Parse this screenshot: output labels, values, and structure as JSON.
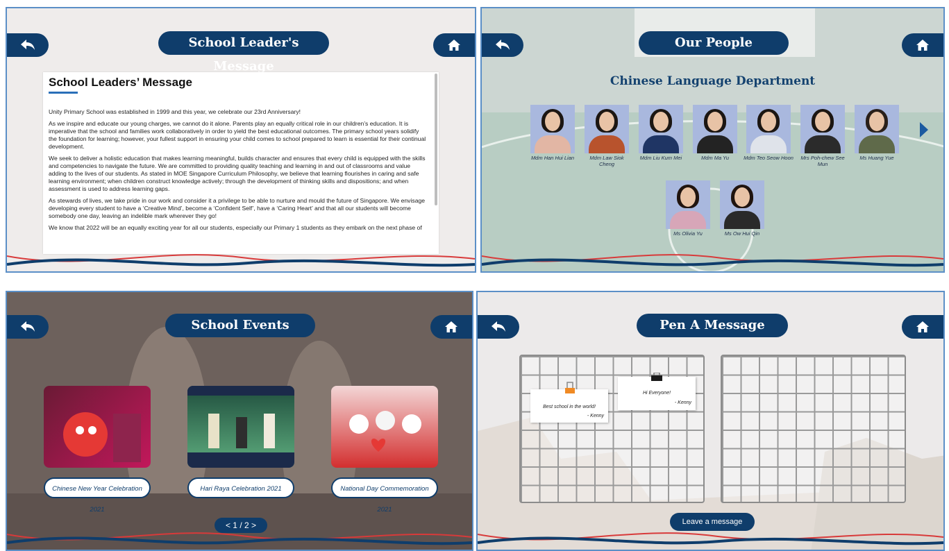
{
  "panels": {
    "leaders": {
      "title": "School Leader's Message",
      "doc_heading": "School Leaders’ Message",
      "paragraphs": [
        "Unity Primary School was established in 1999 and this year, we celebrate our 23rd Anniversary!",
        "As we inspire and educate our young charges, we cannot do it alone. Parents play an equally critical role in our children’s education. It is imperative that the school and families work collaboratively in order to yield the best educational outcomes. The primary school years solidify the foundation for learning; however, your fullest support in ensuring your child comes to school prepared to learn is essential for their continual development.",
        "We seek to deliver a holistic education that makes learning meaningful, builds character and ensures that every child is equipped with the skills and competencies to navigate the future. We are committed to providing quality teaching and learning in and out of classrooms and value adding to the lives of our students. As stated in MOE Singapore Curriculum Philosophy, we believe that learning flourishes in caring and safe learning environment; when children construct knowledge actively; through the development of thinking skills and dispositions; and when assessment is used to address learning gaps.",
        "As stewards of lives, we take pride in our work and consider it a privilege to be able to nurture and mould the future of Singapore. We envisage developing every student to have a ‘Creative Mind’, become a ‘Confident Self’, have a ‘Caring Heart’ and that all our students will become somebody one day, leaving an indelible mark wherever they go!",
        "We know that 2022 will be an equally exciting year for all our students, especially our Primary 1 students as they embark on the next phase of"
      ]
    },
    "people": {
      "title": "Our People",
      "department": "Chinese Language Department",
      "staff": [
        {
          "name": "Mdm Han Hui Lian",
          "top": "#e2b6a4",
          "hair": "#1c1612"
        },
        {
          "name": "Mdm Law Siok Cheng",
          "top": "#b8532d",
          "hair": "#1c1612"
        },
        {
          "name": "Mdm Liu Kum Mei",
          "top": "#1f3564",
          "hair": "#1c1612"
        },
        {
          "name": "Mdm Ma Yu",
          "top": "#232323",
          "hair": "#1c1612"
        },
        {
          "name": "Mdm Teo Seow Hoon",
          "top": "#dfe3ea",
          "hair": "#1c1612"
        },
        {
          "name": "Mrs Poh-chew See Mun",
          "top": "#2b2b2b",
          "hair": "#1c1612"
        },
        {
          "name": "Ms Huang Yue",
          "top": "#5f6a4a",
          "hair": "#2a201a"
        },
        {
          "name": "Ms Olivia Yu",
          "top": "#d7a6b8",
          "hair": "#20140f"
        },
        {
          "name": "Ms Ow Hui Qin",
          "top": "#2a2a2a",
          "hair": "#20140f"
        }
      ]
    },
    "events": {
      "title": "School Events",
      "items": [
        {
          "label": "Chinese New Year Celebration 2021",
          "bg1": "#6a1a35",
          "bg2": "#c2185b",
          "accent": "#e53935"
        },
        {
          "label": "Hari Raya Celebration 2021",
          "bg1": "#1f4e3d",
          "bg2": "#5fae7f",
          "accent": "#1b2a4a"
        },
        {
          "label": "National Day Commemoration 2021",
          "bg1": "#f3d6d6",
          "bg2": "#d32f2f",
          "accent": "#ffffff"
        }
      ],
      "pager": "< 1 / 2 >"
    },
    "message": {
      "title": "Pen A Message",
      "notes": [
        {
          "text": "Best school in the world!",
          "signature": "- Kenny"
        },
        {
          "text": "Hi Everyone!",
          "signature": "- Kenny"
        }
      ],
      "leave_label": "Leave a message"
    }
  },
  "colors": {
    "navy": "#0f3d6b",
    "panel_border": "#5b8fc7",
    "wave_red": "#d83a3a"
  },
  "icons": [
    "back-arrow-icon",
    "home-icon",
    "next-arrow-icon"
  ]
}
